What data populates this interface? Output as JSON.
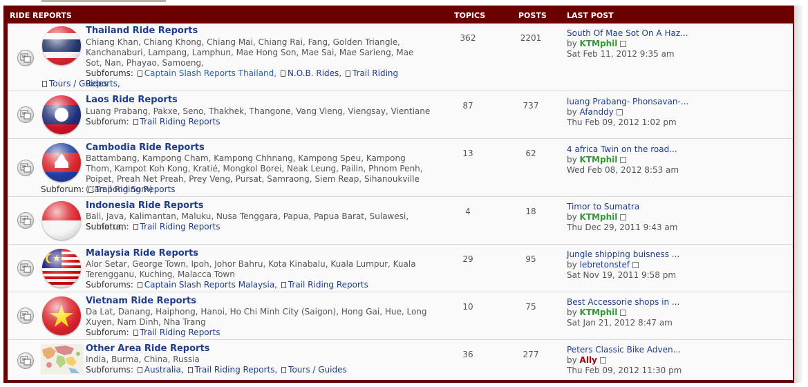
{
  "header": {
    "category": "RIDE REPORTS",
    "topics": "TOPICS",
    "posts": "POSTS",
    "last_post": "LAST POST"
  },
  "forums": [
    {
      "title": "Thailand Ride Reports",
      "desc": "Chiang Khan, Chiang Khong, Chiang Mai, Chiang Rai, Fang, Golden Triangle, Kanchanaburi, Lampang, Lamphun, Mae Hong Son, Mae Sai, Mae Sarieng, Mae Sot, Nan, Phayao, Samoeng,",
      "subforum_label": "Subforums:",
      "subforums": [
        "Captain Slash Reports Thailand,",
        "N.O.B. Rides,",
        "Trail Riding Reports,",
        "Tours / Guides"
      ],
      "topics": "362",
      "posts": "2201",
      "last_post_title": "South Of Mae Sot On A Haz...",
      "last_post_by": "by",
      "last_post_user": "KTMphil",
      "last_post_time": "Sat Feb 11, 2012 9:35 am"
    },
    {
      "title": "Laos Ride Reports",
      "desc": "Luang Prabang, Pakxe, Seno, Thakhek, Thangone, Vang Vieng, Viengsay, Vientiane",
      "subforum_label": "Subforum:",
      "subforums": [
        "Trail Riding Reports"
      ],
      "topics": "87",
      "posts": "737",
      "last_post_title": "luang Prabang- Phonsavan-...",
      "last_post_by": "by",
      "last_post_user": "Afanddy",
      "last_post_time": "Thu Feb 09, 2012 1:02 pm"
    },
    {
      "title": "Cambodia Ride Reports",
      "desc": "Battambang, Kampong Cham, Kampong Chhnang, Kampong Speu, Kampong Thom, Kampot Koh Kong, Kratié, Mongkol Borei, Neak Leung, Pailin, Phnom Penh, Poipet, Preah Net Preah, Prey Veng, Pursat, Samraong, Siem Reap, Sihanoukville (Kampong Som)",
      "subforum_label": "Subforum:",
      "subforums": [
        "Trail Riding Reports"
      ],
      "topics": "13",
      "posts": "62",
      "last_post_title": "4 africa Twin on the road...",
      "last_post_by": "by",
      "last_post_user": "KTMphil",
      "last_post_time": "Wed Feb 08, 2012 8:53 am"
    },
    {
      "title": "Indonesia Ride Reports",
      "desc": "Bali, Java, Kalimantan, Maluku, Nusa Tenggara, Papua, Papua Barat, Sulawesi, Sumatra,",
      "subforum_label": "Subforum:",
      "subforums": [
        "Trail Riding Reports"
      ],
      "topics": "4",
      "posts": "18",
      "last_post_title": "Timor to Sumatra",
      "last_post_by": "by",
      "last_post_user": "KTMphil",
      "last_post_time": "Thu Dec 29, 2011 9:43 am"
    },
    {
      "title": "Malaysia Ride Reports",
      "desc": "Alor Setar, George Town, Ipoh, Johor Bahru, Kota Kinabalu, Kuala Lumpur, Kuala Terengganu, Kuching, Malacca Town",
      "subforum_label": "Subforums:",
      "subforums": [
        "Captain Slash Reports Malaysia,",
        "Trail Riding Reports"
      ],
      "topics": "29",
      "posts": "95",
      "last_post_title": "Jungle shipping buisness ...",
      "last_post_by": "by",
      "last_post_user": "lebretonstef",
      "last_post_time": "Sat Nov 19, 2011 9:58 pm"
    },
    {
      "title": "Vietnam Ride Reports",
      "desc": "Da Lat, Danang, Haiphong, Hanoi, Ho Chi Minh City (Saigon), Hong Gai, Hue, Long Xuyen, Nam Dinh, Nha Trang",
      "subforum_label": "Subforum:",
      "subforums": [
        "Trail Riding Reports"
      ],
      "topics": "10",
      "posts": "75",
      "last_post_title": "Best Accessorie shops in ...",
      "last_post_by": "by",
      "last_post_user": "KTMphil",
      "last_post_time": "Sat Jan 21, 2012 8:47 am"
    },
    {
      "title": "Other Area Ride Reports",
      "desc": "India, Burma, China, Russia",
      "subforum_label": "Subforums:",
      "subforums": [
        "Australia,",
        "Trail Riding Reports,",
        "Tours / Guides"
      ],
      "topics": "36",
      "posts": "277",
      "last_post_title": "Peters Classic Bike Adven...",
      "last_post_by": "by",
      "last_post_user": "Ally",
      "last_post_time": "Thu Feb 09, 2012 11:30 pm"
    }
  ],
  "colors": {
    "frame": "#6b0000",
    "title_link": "#1e3c8c",
    "user_green": "#339933",
    "user_red": "#aa0000"
  }
}
